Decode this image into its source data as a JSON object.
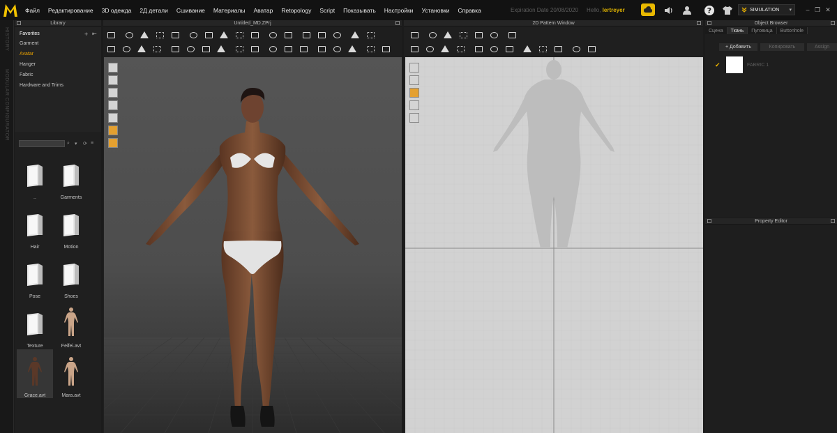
{
  "menubar": {
    "logo": "M",
    "items": [
      "Файл",
      "Редактирование",
      "3D одежда",
      "2Д детали",
      "Сшивание",
      "Материалы",
      "Аватар",
      "Retopology",
      "Script",
      "Показывать",
      "Настройки",
      "Установки",
      "Справка"
    ],
    "expiration_label": "Expiration Date 20/08/2020",
    "hello_label": "Hello,",
    "username": "lertreyer",
    "simulation_label": "SIMULATION"
  },
  "sidestrip": {
    "history": "HISTORY",
    "modular": "MODULAR CONFIGURATOR"
  },
  "library": {
    "title": "Library",
    "tree": [
      "Favorites",
      "Garment",
      "Avatar",
      "Hanger",
      "Fabric",
      "Hardware and Trims"
    ],
    "active": "Avatar",
    "tiles": [
      {
        "label": "..",
        "type": "folder"
      },
      {
        "label": "Garments",
        "type": "folder"
      },
      {
        "label": "Hair",
        "type": "folder"
      },
      {
        "label": "Motion",
        "type": "folder"
      },
      {
        "label": "Pose",
        "type": "folder"
      },
      {
        "label": "Shoes",
        "type": "folder"
      },
      {
        "label": "Texture",
        "type": "folder"
      },
      {
        "label": "Feifei.avt",
        "type": "avatar"
      },
      {
        "label": "Grace.avt",
        "type": "avatar",
        "selected": true
      },
      {
        "label": "Mara.avt",
        "type": "avatar"
      }
    ]
  },
  "viewport3d": {
    "title": "Untitled_MD.ZPrj"
  },
  "pattern2d": {
    "title": "2D Pattern Window"
  },
  "object_browser": {
    "title": "Object Browser",
    "tabs": [
      "Сцена",
      "Ткань",
      "Пуговица",
      "Buttonhole"
    ],
    "active_tab": "Ткань",
    "add_label": "+ Добавить",
    "copy_label": "Копировать",
    "assign_label": "Assign",
    "fabric_name": "FABRIC 1",
    "fabric_color": "#ffffff"
  },
  "property_editor": {
    "title": "Property Editor"
  },
  "colors": {
    "accent": "#e8a100",
    "logo": "#f2c200"
  }
}
